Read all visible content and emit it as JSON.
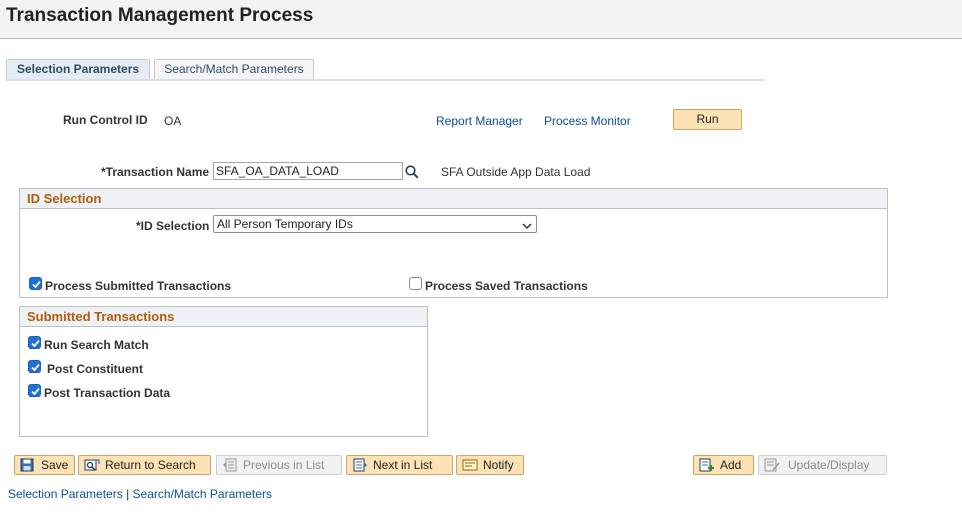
{
  "page": {
    "title": "Transaction Management Process"
  },
  "tabs": [
    {
      "label": "Selection Parameters",
      "active": true
    },
    {
      "label": "Search/Match Parameters",
      "active": false
    }
  ],
  "run_control": {
    "label": "Run Control ID",
    "value": "OA",
    "report_manager": "Report Manager",
    "process_monitor": "Process Monitor",
    "run_label": "Run"
  },
  "transaction": {
    "label": "*Transaction Name",
    "value": "SFA_OA_DATA_LOAD",
    "description": "SFA Outside App Data Load"
  },
  "id_selection": {
    "heading": "ID Selection",
    "label": "*ID Selection",
    "selected": "All Person Temporary IDs",
    "process_submitted": {
      "label": "Process Submitted Transactions",
      "checked": true
    },
    "process_saved": {
      "label": "Process Saved Transactions",
      "checked": false
    }
  },
  "submitted": {
    "heading": "Submitted Transactions",
    "items": [
      {
        "label": "Run Search Match",
        "checked": true
      },
      {
        "label": "Post Constituent",
        "checked": true
      },
      {
        "label": "Post Transaction Data",
        "checked": true
      }
    ]
  },
  "toolbar": {
    "save": "Save",
    "return_to_search": "Return to Search",
    "previous_in_list": "Previous in List",
    "next_in_list": "Next in List",
    "notify": "Notify",
    "add": "Add",
    "update_display": "Update/Display"
  },
  "footer_links": {
    "selection": "Selection Parameters",
    "separator": "|",
    "search_match": "Search/Match Parameters"
  },
  "colors": {
    "accent_button": "#fde2b5",
    "group_heading": "#b45c09",
    "link": "#0b4f96",
    "checkbox": "#1e6fd6"
  }
}
